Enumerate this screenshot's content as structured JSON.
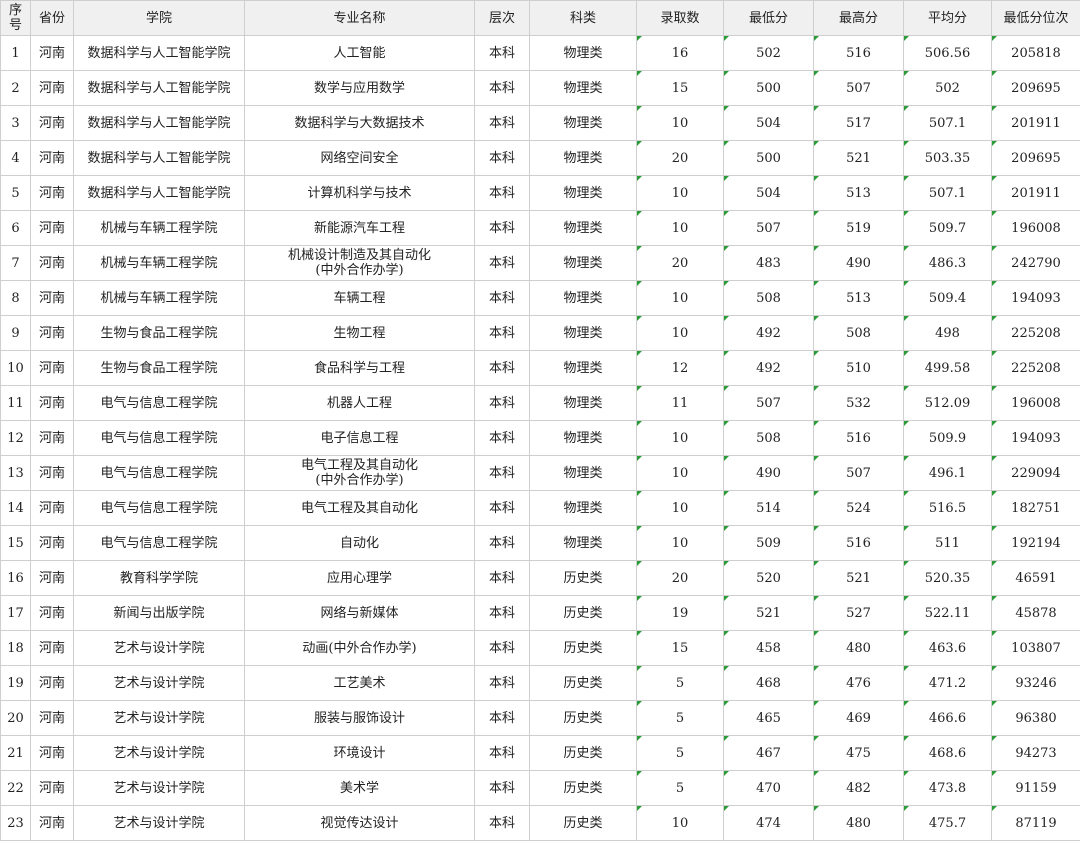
{
  "headers": [
    "序\n号",
    "省份",
    "学院",
    "专业名称",
    "层次",
    "科类",
    "录取数",
    "最低分",
    "最高分",
    "平均分",
    "最低分位次"
  ],
  "rows": [
    [
      "1",
      "河南",
      "数据科学与人工智能学院",
      "人工智能",
      "本科",
      "物理类",
      "16",
      "502",
      "516",
      "506.56",
      "205818"
    ],
    [
      "2",
      "河南",
      "数据科学与人工智能学院",
      "数学与应用数学",
      "本科",
      "物理类",
      "15",
      "500",
      "507",
      "502",
      "209695"
    ],
    [
      "3",
      "河南",
      "数据科学与人工智能学院",
      "数据科学与大数据技术",
      "本科",
      "物理类",
      "10",
      "504",
      "517",
      "507.1",
      "201911"
    ],
    [
      "4",
      "河南",
      "数据科学与人工智能学院",
      "网络空间安全",
      "本科",
      "物理类",
      "20",
      "500",
      "521",
      "503.35",
      "209695"
    ],
    [
      "5",
      "河南",
      "数据科学与人工智能学院",
      "计算机科学与技术",
      "本科",
      "物理类",
      "10",
      "504",
      "513",
      "507.1",
      "201911"
    ],
    [
      "6",
      "河南",
      "机械与车辆工程学院",
      "新能源汽车工程",
      "本科",
      "物理类",
      "10",
      "507",
      "519",
      "509.7",
      "196008"
    ],
    [
      "7",
      "河南",
      "机械与车辆工程学院",
      "机械设计制造及其自动化\n(中外合作办学)",
      "本科",
      "物理类",
      "20",
      "483",
      "490",
      "486.3",
      "242790"
    ],
    [
      "8",
      "河南",
      "机械与车辆工程学院",
      "车辆工程",
      "本科",
      "物理类",
      "10",
      "508",
      "513",
      "509.4",
      "194093"
    ],
    [
      "9",
      "河南",
      "生物与食品工程学院",
      "生物工程",
      "本科",
      "物理类",
      "10",
      "492",
      "508",
      "498",
      "225208"
    ],
    [
      "10",
      "河南",
      "生物与食品工程学院",
      "食品科学与工程",
      "本科",
      "物理类",
      "12",
      "492",
      "510",
      "499.58",
      "225208"
    ],
    [
      "11",
      "河南",
      "电气与信息工程学院",
      "机器人工程",
      "本科",
      "物理类",
      "11",
      "507",
      "532",
      "512.09",
      "196008"
    ],
    [
      "12",
      "河南",
      "电气与信息工程学院",
      "电子信息工程",
      "本科",
      "物理类",
      "10",
      "508",
      "516",
      "509.9",
      "194093"
    ],
    [
      "13",
      "河南",
      "电气与信息工程学院",
      "电气工程及其自动化\n(中外合作办学)",
      "本科",
      "物理类",
      "10",
      "490",
      "507",
      "496.1",
      "229094"
    ],
    [
      "14",
      "河南",
      "电气与信息工程学院",
      "电气工程及其自动化",
      "本科",
      "物理类",
      "10",
      "514",
      "524",
      "516.5",
      "182751"
    ],
    [
      "15",
      "河南",
      "电气与信息工程学院",
      "自动化",
      "本科",
      "物理类",
      "10",
      "509",
      "516",
      "511",
      "192194"
    ],
    [
      "16",
      "河南",
      "教育科学学院",
      "应用心理学",
      "本科",
      "历史类",
      "20",
      "520",
      "521",
      "520.35",
      "46591"
    ],
    [
      "17",
      "河南",
      "新闻与出版学院",
      "网络与新媒体",
      "本科",
      "历史类",
      "19",
      "521",
      "527",
      "522.11",
      "45878"
    ],
    [
      "18",
      "河南",
      "艺术与设计学院",
      "动画(中外合作办学)",
      "本科",
      "历史类",
      "15",
      "458",
      "480",
      "463.6",
      "103807"
    ],
    [
      "19",
      "河南",
      "艺术与设计学院",
      "工艺美术",
      "本科",
      "历史类",
      "5",
      "468",
      "476",
      "471.2",
      "93246"
    ],
    [
      "20",
      "河南",
      "艺术与设计学院",
      "服装与服饰设计",
      "本科",
      "历史类",
      "5",
      "465",
      "469",
      "466.6",
      "96380"
    ],
    [
      "21",
      "河南",
      "艺术与设计学院",
      "环境设计",
      "本科",
      "历史类",
      "5",
      "467",
      "475",
      "468.6",
      "94273"
    ],
    [
      "22",
      "河南",
      "艺术与设计学院",
      "美术学",
      "本科",
      "历史类",
      "5",
      "470",
      "482",
      "473.8",
      "91159"
    ],
    [
      "23",
      "河南",
      "艺术与设计学院",
      "视觉传达设计",
      "本科",
      "历史类",
      "10",
      "474",
      "480",
      "475.7",
      "87119"
    ]
  ],
  "colors": {
    "grid": "#cfcfcf",
    "header_bg": "#f0f0f0",
    "marker": "#2e9b3a"
  }
}
